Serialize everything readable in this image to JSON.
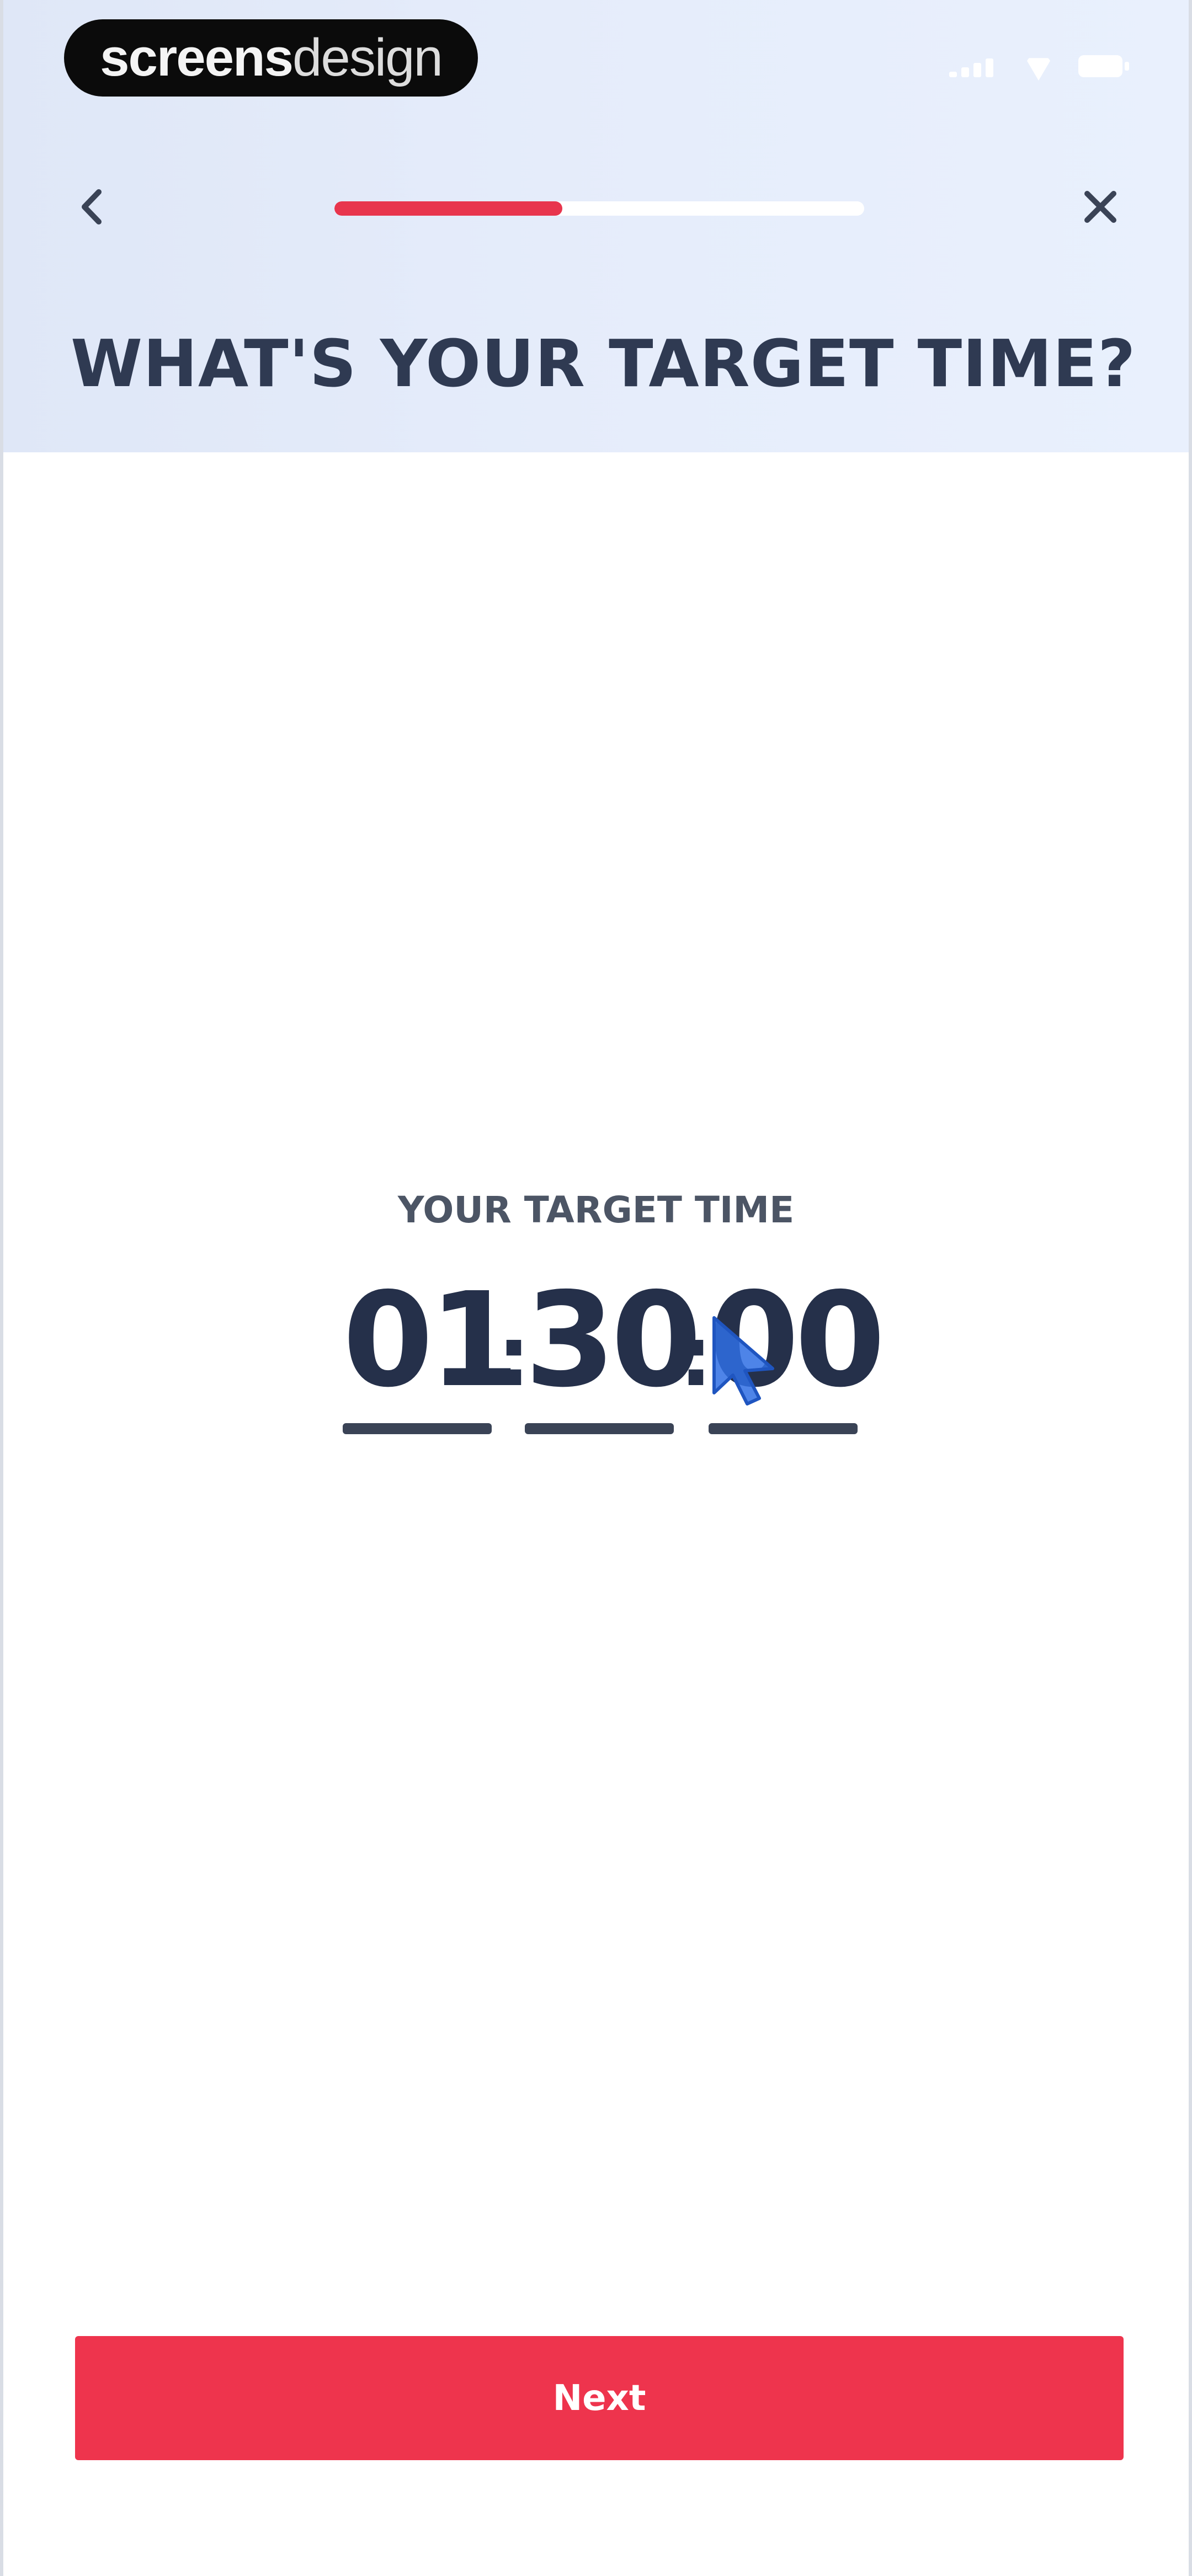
{
  "status_bar": {
    "brand_light": "screens",
    "brand_bold": "design"
  },
  "colors": {
    "accent": "#ee344d",
    "header_gradient_start": "#dfe7f7",
    "header_gradient_end": "#e9f0fd",
    "title_text": "#2f3a52",
    "digits_text": "#25304a"
  },
  "nav": {
    "back_icon": "chevron-left-icon",
    "close_icon": "close-icon",
    "progress_fraction": 0.43
  },
  "page": {
    "title": "WHAT'S YOUR TARGET TIME?"
  },
  "target_time": {
    "label": "YOUR TARGET TIME",
    "hours": "01",
    "minutes": "30",
    "seconds": "00",
    "separator": ":"
  },
  "footer": {
    "next_label": "Next"
  }
}
